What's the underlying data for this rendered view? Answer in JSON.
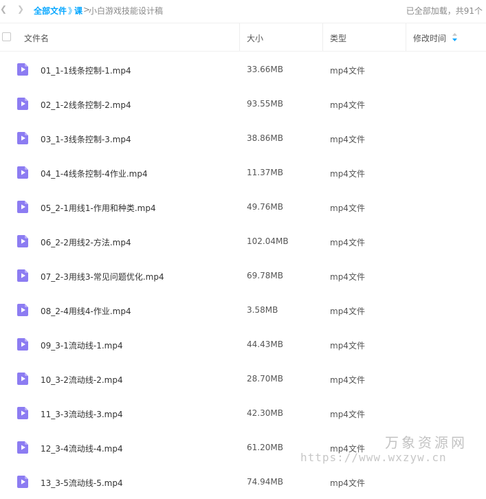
{
  "nav": {
    "back_icon": "chevron-left-icon",
    "forward_icon": "chevron-right-icon"
  },
  "breadcrumb": {
    "root": "全部文件",
    "sep1": "》",
    "folder": "课",
    "sep2": ">",
    "current": "小白游戏技能设计稿"
  },
  "load_status": "已全部加载，共91个",
  "columns": {
    "name": "文件名",
    "size": "大小",
    "type": "类型",
    "modified": "修改时间"
  },
  "colors": {
    "accent": "#06a7ff",
    "file_icon": "#8c7cf2"
  },
  "files": [
    {
      "name": "01_1-1线条控制-1.mp4",
      "size": "33.66MB",
      "type": "mp4文件"
    },
    {
      "name": "02_1-2线条控制-2.mp4",
      "size": "93.55MB",
      "type": "mp4文件"
    },
    {
      "name": "03_1-3线条控制-3.mp4",
      "size": "38.86MB",
      "type": "mp4文件"
    },
    {
      "name": "04_1-4线条控制-4作业.mp4",
      "size": "11.37MB",
      "type": "mp4文件"
    },
    {
      "name": "05_2-1用线1-作用和种类.mp4",
      "size": "49.76MB",
      "type": "mp4文件"
    },
    {
      "name": "06_2-2用线2-方法.mp4",
      "size": "102.04MB",
      "type": "mp4文件"
    },
    {
      "name": "07_2-3用线3-常见问题优化.mp4",
      "size": "69.78MB",
      "type": "mp4文件"
    },
    {
      "name": "08_2-4用线4-作业.mp4",
      "size": "3.58MB",
      "type": "mp4文件"
    },
    {
      "name": "09_3-1流动线-1.mp4",
      "size": "44.43MB",
      "type": "mp4文件"
    },
    {
      "name": "10_3-2流动线-2.mp4",
      "size": "28.70MB",
      "type": "mp4文件"
    },
    {
      "name": "11_3-3流动线-3.mp4",
      "size": "42.30MB",
      "type": "mp4文件"
    },
    {
      "name": "12_3-4流动线-4.mp4",
      "size": "61.20MB",
      "type": "mp4文件"
    },
    {
      "name": "13_3-5流动线-5.mp4",
      "size": "74.94MB",
      "type": "mp4文件"
    }
  ],
  "watermark": {
    "name": "万象资源网",
    "url": "https://www.wxzyw.cn"
  }
}
